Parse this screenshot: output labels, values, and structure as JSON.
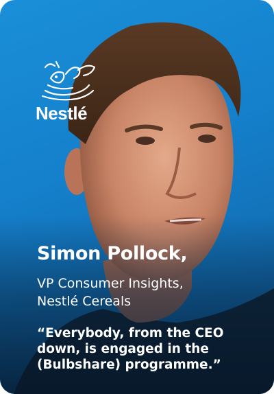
{
  "brand": {
    "logo_text": "Nestlé",
    "background_color": "#1a8fd8"
  },
  "person": {
    "name": "Simon Pollock,",
    "role_lines": [
      "VP Consumer Insights,",
      "Nestlé Cereals"
    ]
  },
  "quote": {
    "lines": [
      "“Everybody, from the CEO",
      "down, is engaged in the",
      "(Bulbshare) programme.”"
    ]
  }
}
